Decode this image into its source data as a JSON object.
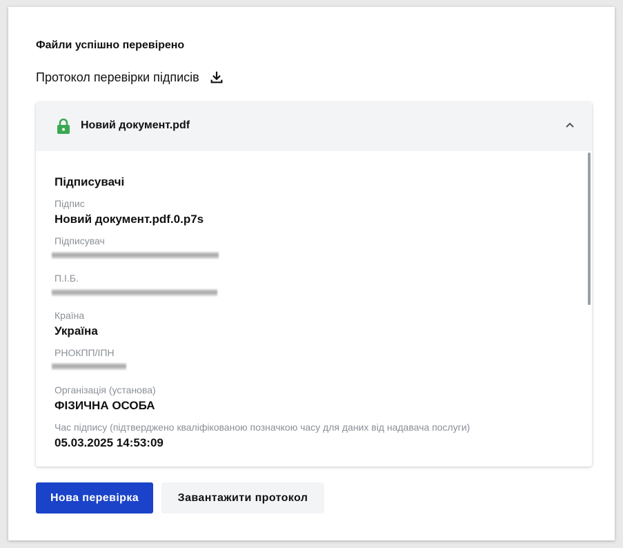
{
  "status": {
    "title": "Файли успішно перевірено"
  },
  "protocol": {
    "label": "Протокол перевірки підписів",
    "icon": "download-icon"
  },
  "document": {
    "name": "Новий документ.pdf",
    "status_icon": "lock-icon",
    "status_color": "#3aa853",
    "toggle_icon": "chevron-up-icon"
  },
  "signers": {
    "section_title": "Підписувачі",
    "fields": {
      "signature": {
        "label": "Підпис",
        "value": "Новий документ.pdf.0.p7s"
      },
      "signer": {
        "label": "Підписувач",
        "value": ""
      },
      "full_name": {
        "label": "П.І.Б.",
        "value": ""
      },
      "country": {
        "label": "Країна",
        "value": "Україна"
      },
      "tax_id": {
        "label": "РНОКПП/ІПН",
        "value": ""
      },
      "organization": {
        "label": "Організація (установа)",
        "value": "ФІЗИЧНА ОСОБА"
      },
      "sign_time": {
        "label": "Час підпису (підтверджено кваліфікованою позначкою часу для даних від надавача послуги)",
        "value": "05.03.2025 14:53:09"
      }
    }
  },
  "actions": {
    "new_check_label": "Нова перевірка",
    "download_protocol_label": "Завантажити протокол",
    "primary_color": "#1a43c9"
  }
}
